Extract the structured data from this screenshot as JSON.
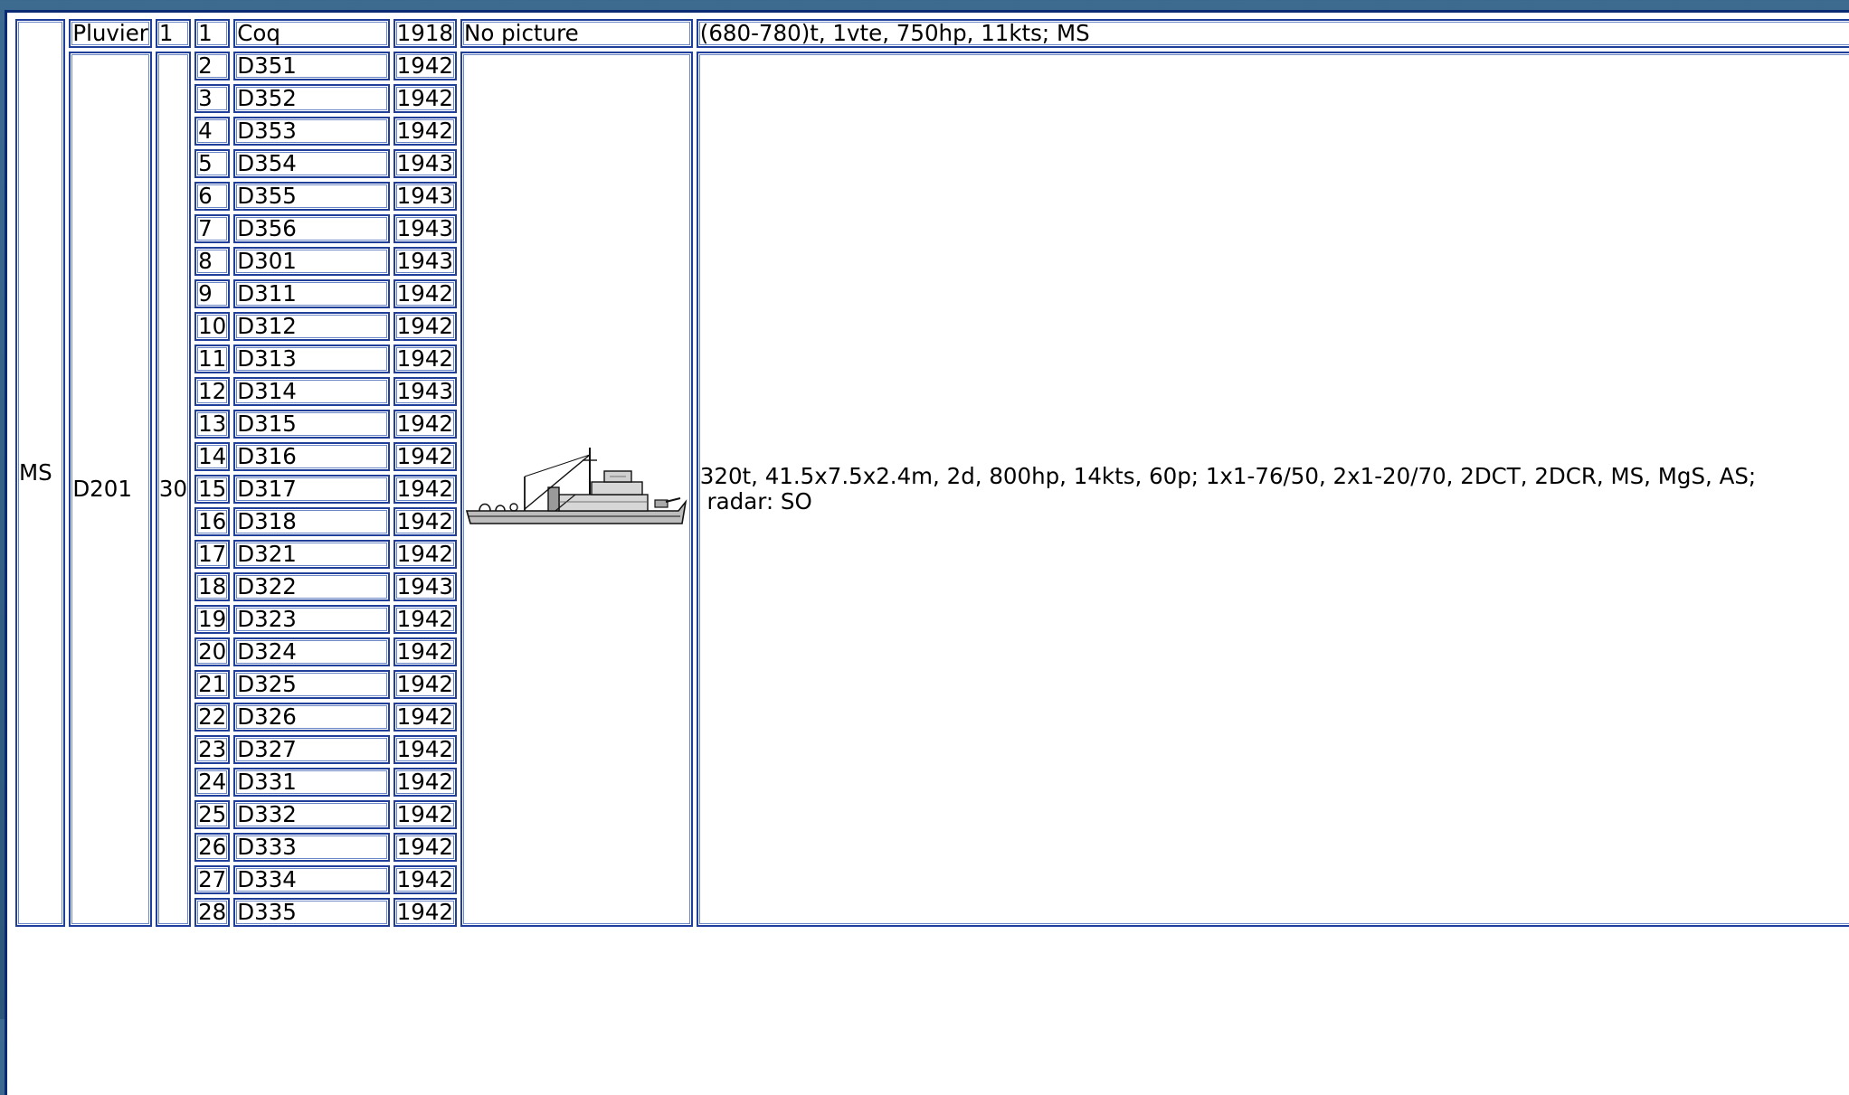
{
  "type_label": "MS",
  "class1": {
    "name": "Pluvier",
    "count": "1",
    "number": "1",
    "ship": "Coq",
    "year": "1918",
    "picture_label": "No picture",
    "specs": "(680-780)t, 1vte, 750hp, 11kts; MS"
  },
  "class2": {
    "name": "D201",
    "count": "30",
    "picture_icon": "minesweeper-ship-drawing",
    "specs_line1": "320t, 41.5x7.5x2.4m, 2d, 800hp, 14kts, 60p; 1x1-76/50, 2x1-20/70, 2DCT, 2DCR, MS, MgS, AS;",
    "specs_line2": " radar: SO",
    "ships": [
      {
        "number": "2",
        "name": "D351",
        "year": "1942"
      },
      {
        "number": "3",
        "name": "D352",
        "year": "1942"
      },
      {
        "number": "4",
        "name": "D353",
        "year": "1942"
      },
      {
        "number": "5",
        "name": "D354",
        "year": "1943"
      },
      {
        "number": "6",
        "name": "D355",
        "year": "1943"
      },
      {
        "number": "7",
        "name": "D356",
        "year": "1943"
      },
      {
        "number": "8",
        "name": "D301",
        "year": "1943"
      },
      {
        "number": "9",
        "name": "D311",
        "year": "1942"
      },
      {
        "number": "10",
        "name": "D312",
        "year": "1942"
      },
      {
        "number": "11",
        "name": "D313",
        "year": "1942"
      },
      {
        "number": "12",
        "name": "D314",
        "year": "1943"
      },
      {
        "number": "13",
        "name": "D315",
        "year": "1942"
      },
      {
        "number": "14",
        "name": "D316",
        "year": "1942"
      },
      {
        "number": "15",
        "name": "D317",
        "year": "1942"
      },
      {
        "number": "16",
        "name": "D318",
        "year": "1942"
      },
      {
        "number": "17",
        "name": "D321",
        "year": "1942"
      },
      {
        "number": "18",
        "name": "D322",
        "year": "1943"
      },
      {
        "number": "19",
        "name": "D323",
        "year": "1942"
      },
      {
        "number": "20",
        "name": "D324",
        "year": "1942"
      },
      {
        "number": "21",
        "name": "D325",
        "year": "1942"
      },
      {
        "number": "22",
        "name": "D326",
        "year": "1942"
      },
      {
        "number": "23",
        "name": "D327",
        "year": "1942"
      },
      {
        "number": "24",
        "name": "D331",
        "year": "1942"
      },
      {
        "number": "25",
        "name": "D332",
        "year": "1942"
      },
      {
        "number": "26",
        "name": "D333",
        "year": "1942"
      },
      {
        "number": "27",
        "name": "D334",
        "year": "1942"
      },
      {
        "number": "28",
        "name": "D335",
        "year": "1942"
      }
    ]
  }
}
